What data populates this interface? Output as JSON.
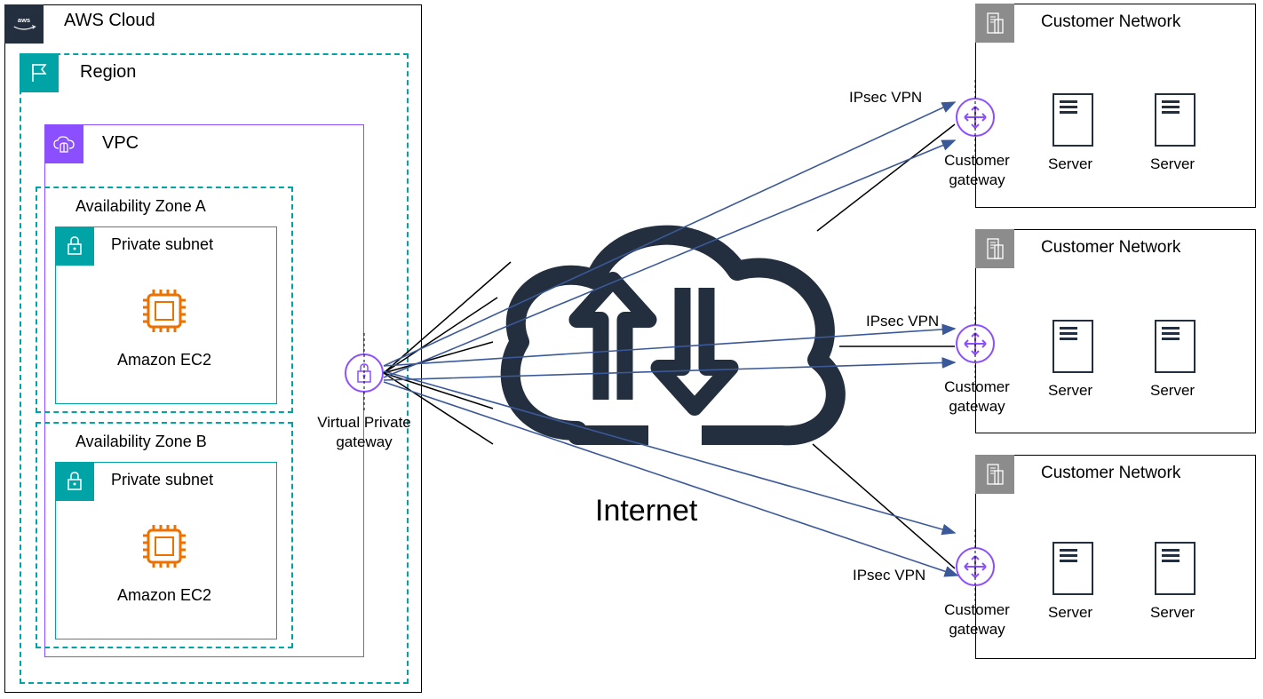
{
  "aws_cloud": "AWS Cloud",
  "region": "Region",
  "vpc": "VPC",
  "az_a": "Availability Zone A",
  "az_b": "Availability Zone B",
  "private_subnet": "Private subnet",
  "ec2": "Amazon EC2",
  "vpg": "Virtual Private gateway",
  "internet": "Internet",
  "ipsec": "IPsec VPN",
  "cgw": "Customer gateway",
  "customer_network": "Customer Network",
  "server": "Server"
}
